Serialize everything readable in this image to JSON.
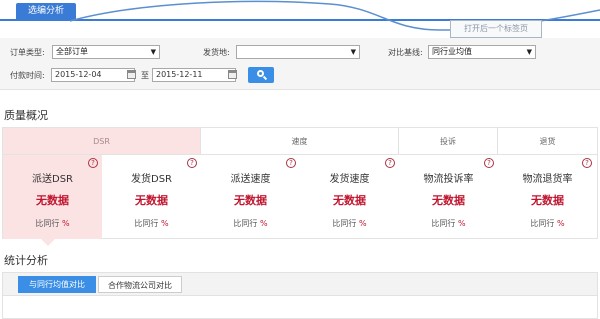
{
  "top_tab": {
    "label": "选编分析"
  },
  "tooltip": {
    "text": "打开后一个标签页"
  },
  "filters": {
    "order_type_label": "订单类型:",
    "order_type_value": "全部订单",
    "ship_from_label": "发货地:",
    "ship_from_value": "",
    "compare_label": "对比基线:",
    "compare_value": "同行业均值",
    "pay_time_label": "付款时间:",
    "date_from": "2015-12-04",
    "to_label": "至",
    "date_to": "2015-12-11"
  },
  "quality": {
    "title": "质量概况",
    "groups": [
      {
        "label": "DSR"
      },
      {
        "label": "速度"
      },
      {
        "label": "投诉"
      },
      {
        "label": "退货"
      }
    ],
    "metrics": [
      {
        "name": "派送DSR",
        "value": "无数据",
        "cmp_label": "比同行",
        "cmp_unit": "%"
      },
      {
        "name": "发货DSR",
        "value": "无数据",
        "cmp_label": "比同行",
        "cmp_unit": "%"
      },
      {
        "name": "派送速度",
        "value": "无数据",
        "cmp_label": "比同行",
        "cmp_unit": "%"
      },
      {
        "name": "发货速度",
        "value": "无数据",
        "cmp_label": "比同行",
        "cmp_unit": "%"
      },
      {
        "name": "物流投诉率",
        "value": "无数据",
        "cmp_label": "比同行",
        "cmp_unit": "%"
      },
      {
        "name": "物流退货率",
        "value": "无数据",
        "cmp_label": "比同行",
        "cmp_unit": "%"
      }
    ],
    "help_glyph": "?"
  },
  "stats": {
    "title": "统计分析",
    "tabs": [
      {
        "label": "与同行均值对比"
      },
      {
        "label": "合作物流公司对比"
      }
    ]
  },
  "colors": {
    "accent": "#3a8ee6",
    "highlight_bg": "#fbe3e4",
    "value_red": "#c0152f"
  }
}
